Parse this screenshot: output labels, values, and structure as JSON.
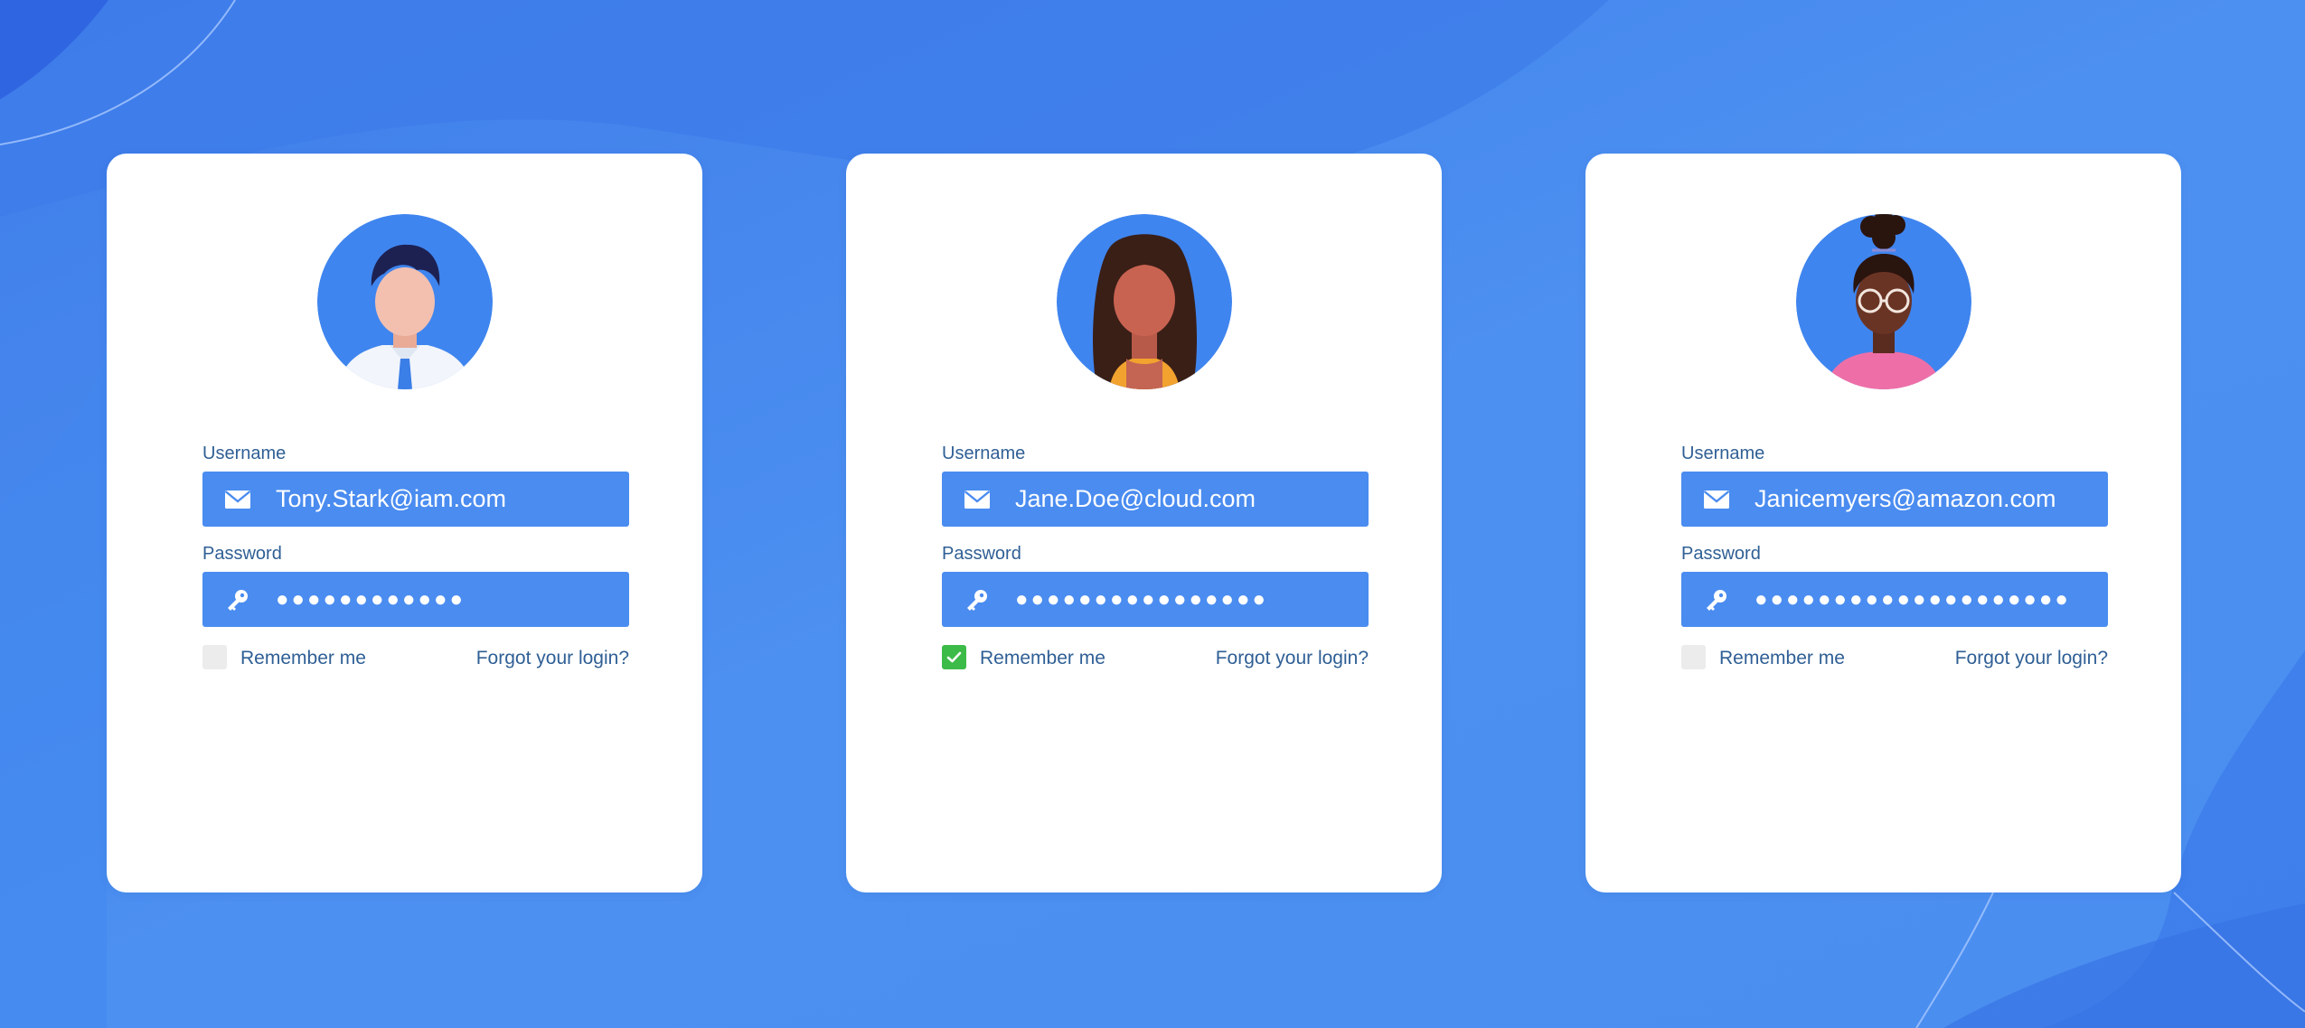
{
  "colors": {
    "background": "#4a8ef0",
    "card": "#ffffff",
    "input": "#4a8cf0",
    "label": "#2f5f95",
    "checked": "#3dbb48",
    "unchecked": "#ececec"
  },
  "cards": [
    {
      "avatar": "male-avatar-with-tie",
      "username_label": "Username",
      "username_value": "Tony.Stark@iam.com",
      "password_label": "Password",
      "password_value": "●●●●●●●●●●●●",
      "remember_label": "Remember me",
      "remember_checked": false,
      "forgot_label": "Forgot your login?"
    },
    {
      "avatar": "female-avatar-long-hair",
      "username_label": "Username",
      "username_value": "Jane.Doe@cloud.com",
      "password_label": "Password",
      "password_value": "●●●●●●●●●●●●●●●●",
      "remember_label": "Remember me",
      "remember_checked": true,
      "forgot_label": "Forgot your login?"
    },
    {
      "avatar": "female-avatar-glasses-bun",
      "username_label": "Username",
      "username_value": "Janicemyers@amazon.com",
      "password_label": "Password",
      "password_value": "●●●●●●●●●●●●●●●●●●●●",
      "remember_label": "Remember me",
      "remember_checked": false,
      "forgot_label": "Forgot your login?"
    }
  ]
}
